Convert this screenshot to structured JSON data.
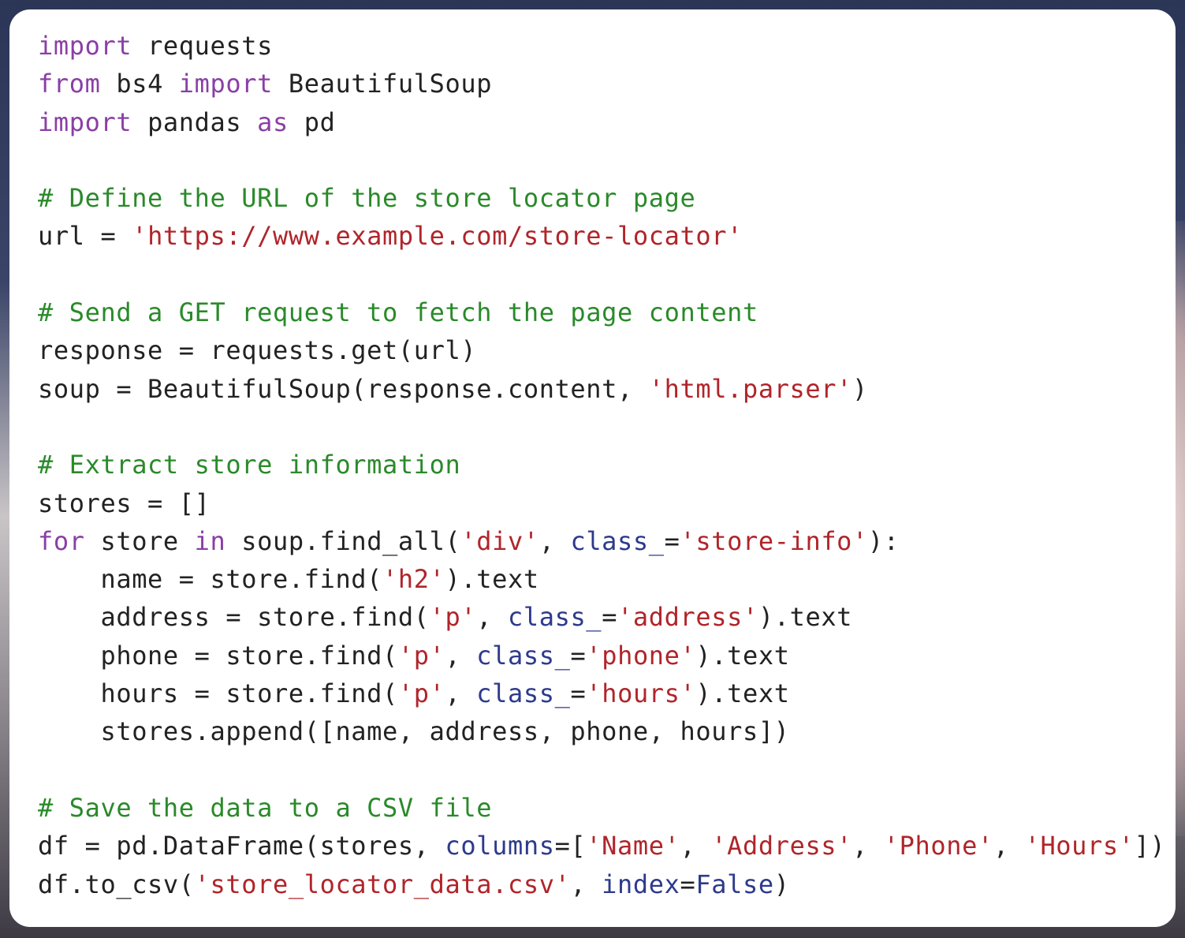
{
  "code": {
    "language": "python",
    "lines": [
      [
        {
          "t": "kw",
          "s": "import"
        },
        {
          "t": "tx",
          "s": " requests"
        }
      ],
      [
        {
          "t": "kw",
          "s": "from"
        },
        {
          "t": "tx",
          "s": " bs4 "
        },
        {
          "t": "kw",
          "s": "import"
        },
        {
          "t": "tx",
          "s": " BeautifulSoup"
        }
      ],
      [
        {
          "t": "kw",
          "s": "import"
        },
        {
          "t": "tx",
          "s": " pandas "
        },
        {
          "t": "kw",
          "s": "as"
        },
        {
          "t": "tx",
          "s": " pd"
        }
      ],
      [],
      [
        {
          "t": "cm",
          "s": "# Define the URL of the store locator page"
        }
      ],
      [
        {
          "t": "tx",
          "s": "url = "
        },
        {
          "t": "st",
          "s": "'https://www.example.com/store-locator'"
        }
      ],
      [],
      [
        {
          "t": "cm",
          "s": "# Send a GET request to fetch the page content"
        }
      ],
      [
        {
          "t": "tx",
          "s": "response = requests.get(url)"
        }
      ],
      [
        {
          "t": "tx",
          "s": "soup = BeautifulSoup(response.content, "
        },
        {
          "t": "st",
          "s": "'html.parser'"
        },
        {
          "t": "tx",
          "s": ")"
        }
      ],
      [],
      [
        {
          "t": "cm",
          "s": "# Extract store information"
        }
      ],
      [
        {
          "t": "tx",
          "s": "stores = []"
        }
      ],
      [
        {
          "t": "kw",
          "s": "for"
        },
        {
          "t": "tx",
          "s": " store "
        },
        {
          "t": "kw",
          "s": "in"
        },
        {
          "t": "tx",
          "s": " soup.find_all("
        },
        {
          "t": "st",
          "s": "'div'"
        },
        {
          "t": "tx",
          "s": ", "
        },
        {
          "t": "pa",
          "s": "class_"
        },
        {
          "t": "tx",
          "s": "="
        },
        {
          "t": "st",
          "s": "'store-info'"
        },
        {
          "t": "tx",
          "s": "):"
        }
      ],
      [
        {
          "t": "tx",
          "s": "    name = store.find("
        },
        {
          "t": "st",
          "s": "'h2'"
        },
        {
          "t": "tx",
          "s": ").text"
        }
      ],
      [
        {
          "t": "tx",
          "s": "    address = store.find("
        },
        {
          "t": "st",
          "s": "'p'"
        },
        {
          "t": "tx",
          "s": ", "
        },
        {
          "t": "pa",
          "s": "class_"
        },
        {
          "t": "tx",
          "s": "="
        },
        {
          "t": "st",
          "s": "'address'"
        },
        {
          "t": "tx",
          "s": ").text"
        }
      ],
      [
        {
          "t": "tx",
          "s": "    phone = store.find("
        },
        {
          "t": "st",
          "s": "'p'"
        },
        {
          "t": "tx",
          "s": ", "
        },
        {
          "t": "pa",
          "s": "class_"
        },
        {
          "t": "tx",
          "s": "="
        },
        {
          "t": "st",
          "s": "'phone'"
        },
        {
          "t": "tx",
          "s": ").text"
        }
      ],
      [
        {
          "t": "tx",
          "s": "    hours = store.find("
        },
        {
          "t": "st",
          "s": "'p'"
        },
        {
          "t": "tx",
          "s": ", "
        },
        {
          "t": "pa",
          "s": "class_"
        },
        {
          "t": "tx",
          "s": "="
        },
        {
          "t": "st",
          "s": "'hours'"
        },
        {
          "t": "tx",
          "s": ").text"
        }
      ],
      [
        {
          "t": "tx",
          "s": "    stores.append([name, address, phone, hours])"
        }
      ],
      [],
      [
        {
          "t": "cm",
          "s": "# Save the data to a CSV file"
        }
      ],
      [
        {
          "t": "tx",
          "s": "df = pd.DataFrame(stores, "
        },
        {
          "t": "pa",
          "s": "columns"
        },
        {
          "t": "tx",
          "s": "=["
        },
        {
          "t": "st",
          "s": "'Name'"
        },
        {
          "t": "tx",
          "s": ", "
        },
        {
          "t": "st",
          "s": "'Address'"
        },
        {
          "t": "tx",
          "s": ", "
        },
        {
          "t": "st",
          "s": "'Phone'"
        },
        {
          "t": "tx",
          "s": ", "
        },
        {
          "t": "st",
          "s": "'Hours'"
        },
        {
          "t": "tx",
          "s": "])"
        }
      ],
      [
        {
          "t": "tx",
          "s": "df.to_csv("
        },
        {
          "t": "st",
          "s": "'store_locator_data.csv'"
        },
        {
          "t": "tx",
          "s": ", "
        },
        {
          "t": "pa",
          "s": "index"
        },
        {
          "t": "tx",
          "s": "="
        },
        {
          "t": "bi",
          "s": "False"
        },
        {
          "t": "tx",
          "s": ")"
        }
      ]
    ]
  },
  "colors": {
    "keyword": "#8a3fa6",
    "comment": "#2a8a2a",
    "string": "#b0252a",
    "parameter": "#2d3a8c",
    "builtin": "#2d3a8c",
    "text": "#222222",
    "card_background": "#ffffff"
  }
}
